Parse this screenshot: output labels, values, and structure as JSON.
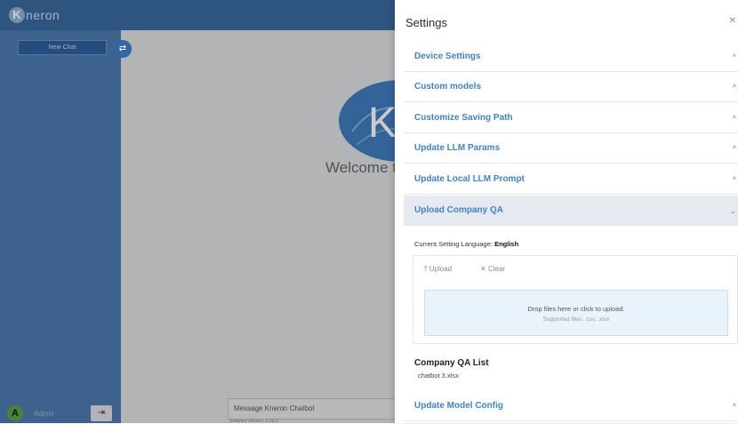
{
  "app": {
    "logo_letter": "K",
    "logo_text": "neron",
    "new_chat_label": "New Chat",
    "swap_icon": "⇄",
    "user_initial": "A",
    "user_name": "Admin",
    "logout_icon": "⇥",
    "welcome_text": "Welcome t",
    "hero_text": "Kn",
    "message_placeholder": "Message Kneron Chatbot",
    "software_version": "Software Version: 0.29.0"
  },
  "settings": {
    "title": "Settings",
    "close_icon": "✕",
    "sections": [
      {
        "label": "Device Settings",
        "chevron": "^"
      },
      {
        "label": "Custom models",
        "chevron": "^"
      },
      {
        "label": "Customize Saving Path",
        "chevron": "^"
      },
      {
        "label": "Update LLM Params",
        "chevron": "^"
      },
      {
        "label": "Update Local LLM Prompt",
        "chevron": "^"
      },
      {
        "label": "Upload Company QA",
        "chevron": "⌄"
      },
      {
        "label": "Update Model Config",
        "chevron": "^"
      }
    ],
    "language_label": "Current Setting Language:",
    "language_value": "English",
    "upload_label": "Upload",
    "clear_label": "Clear",
    "drop_text": "Drop files here or click to upload.",
    "supported_text": "Supported files: .csv, .xlsx",
    "qa_list_title": "Company QA List",
    "qa_file": "chatbot 3.xlsx"
  },
  "colors": {
    "accent": "#3d84c4",
    "sidebar": "#4d7bb1",
    "topbar": "#3a6aa0"
  }
}
